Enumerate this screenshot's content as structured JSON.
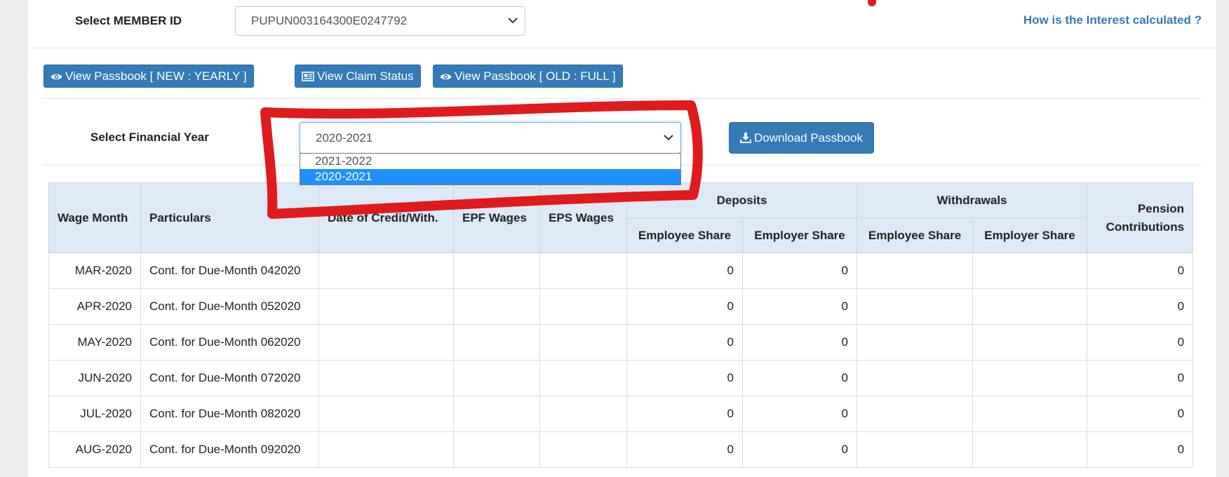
{
  "member": {
    "label": "Select MEMBER ID",
    "selected": "PUPUN003164300E0247792",
    "interest_link": "How is the Interest calculated ?"
  },
  "buttons": {
    "passbook_new": "View Passbook [ NEW : YEARLY ]",
    "claim_status": "View Claim Status",
    "passbook_old": "View Passbook [ OLD : FULL ]"
  },
  "financial_year": {
    "label": "Select Financial Year",
    "selected": "2020-2021",
    "options": [
      "2021-2022",
      "2020-2021"
    ]
  },
  "download_button": "Download Passbook",
  "table": {
    "headers": {
      "wage_month": "Wage Month",
      "particulars": "Particulars",
      "date": "Date of Credit/With.",
      "epf_wages": "EPF Wages",
      "eps_wages": "EPS Wages",
      "deposits": "Deposits",
      "withdrawals": "Withdrawals",
      "pension_line1": "Pension",
      "pension_line2": "Contributions",
      "employee_share": "Employee Share",
      "employer_share": "Employer Share"
    },
    "rows": [
      {
        "month": "MAR-2020",
        "particulars": "Cont. for Due-Month 042020",
        "dep_emp": "0",
        "dep_er": "0",
        "pension": "0"
      },
      {
        "month": "APR-2020",
        "particulars": "Cont. for Due-Month 052020",
        "dep_emp": "0",
        "dep_er": "0",
        "pension": "0"
      },
      {
        "month": "MAY-2020",
        "particulars": "Cont. for Due-Month 062020",
        "dep_emp": "0",
        "dep_er": "0",
        "pension": "0"
      },
      {
        "month": "JUN-2020",
        "particulars": "Cont. for Due-Month 072020",
        "dep_emp": "0",
        "dep_er": "0",
        "pension": "0"
      },
      {
        "month": "JUL-2020",
        "particulars": "Cont. for Due-Month 082020",
        "dep_emp": "0",
        "dep_er": "0",
        "pension": "0"
      },
      {
        "month": "AUG-2020",
        "particulars": "Cont. for Due-Month 092020",
        "dep_emp": "0",
        "dep_er": "0",
        "pension": "0"
      }
    ]
  },
  "colors": {
    "primary": "#337ab7",
    "header_bg": "#dde9f7",
    "annotation": "#e01b1b",
    "dropdown_highlight": "#1e90ff"
  }
}
